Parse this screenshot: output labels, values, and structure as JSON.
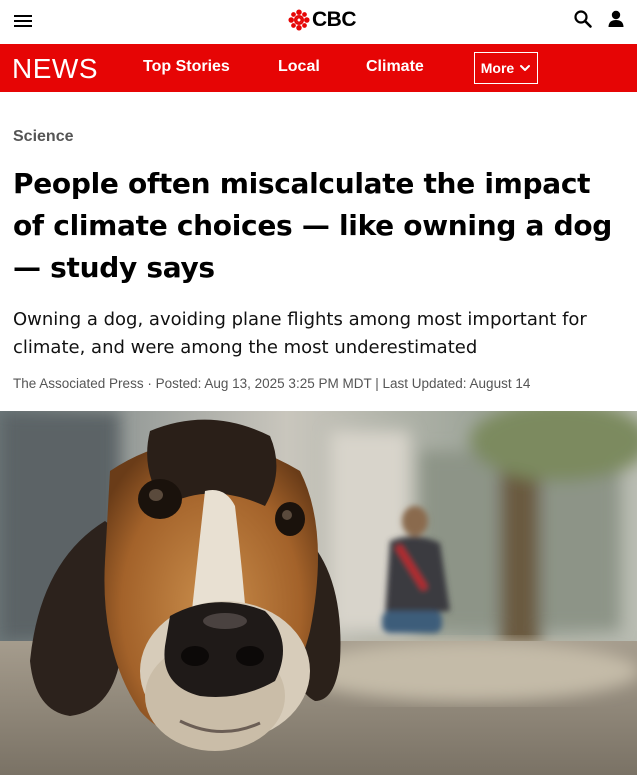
{
  "header": {
    "brand": "CBC",
    "icons": [
      "hamburger-menu-icon",
      "cbc-gem-logo",
      "search-icon",
      "user-account-icon"
    ]
  },
  "nav": {
    "section_title": "NEWS",
    "links": [
      "Top Stories",
      "Local",
      "Climate"
    ],
    "more_label": "More",
    "accent_color": "#e60505"
  },
  "article": {
    "section": "Science",
    "headline": "People often miscalculate the impact of climate choices — like owning a dog — study says",
    "deck": "Owning a dog, avoiding plane flights among most important for climate, and were among the most underestimated",
    "byline": {
      "source": "The Associated Press",
      "separator": " · ",
      "posted": "Posted: Aug 13, 2025 3:25 PM MDT",
      "divider": " | ",
      "updated": "Last Updated: August 14"
    }
  }
}
